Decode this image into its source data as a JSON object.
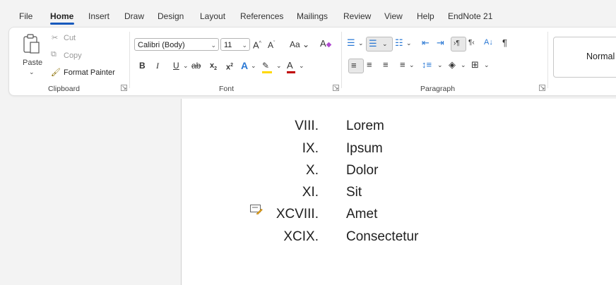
{
  "menu": {
    "items": [
      "File",
      "Home",
      "Insert",
      "Draw",
      "Design",
      "Layout",
      "References",
      "Mailings",
      "Review",
      "View",
      "Help",
      "EndNote 21"
    ]
  },
  "clipboard": {
    "paste": "Paste",
    "cut": "Cut",
    "copy": "Copy",
    "format_painter": "Format Painter",
    "label": "Clipboard"
  },
  "font": {
    "name": "Calibri (Body)",
    "size": "11",
    "change_case": "Aa",
    "label": "Font"
  },
  "paragraph": {
    "label": "Paragraph"
  },
  "styles": {
    "normal": "Normal"
  },
  "document": {
    "list": [
      {
        "num": "VIII.",
        "text": "Lorem"
      },
      {
        "num": "IX.",
        "text": "Ipsum"
      },
      {
        "num": "X.",
        "text": "Dolor"
      },
      {
        "num": "XI.",
        "text": "Sit"
      },
      {
        "num": "XCVIII.",
        "text": "Amet"
      },
      {
        "num": "XCIX.",
        "text": "Consectetur"
      }
    ]
  },
  "colors": {
    "accent": "#185abd",
    "font_color": "#c00000",
    "highlight": "#ffd800"
  }
}
